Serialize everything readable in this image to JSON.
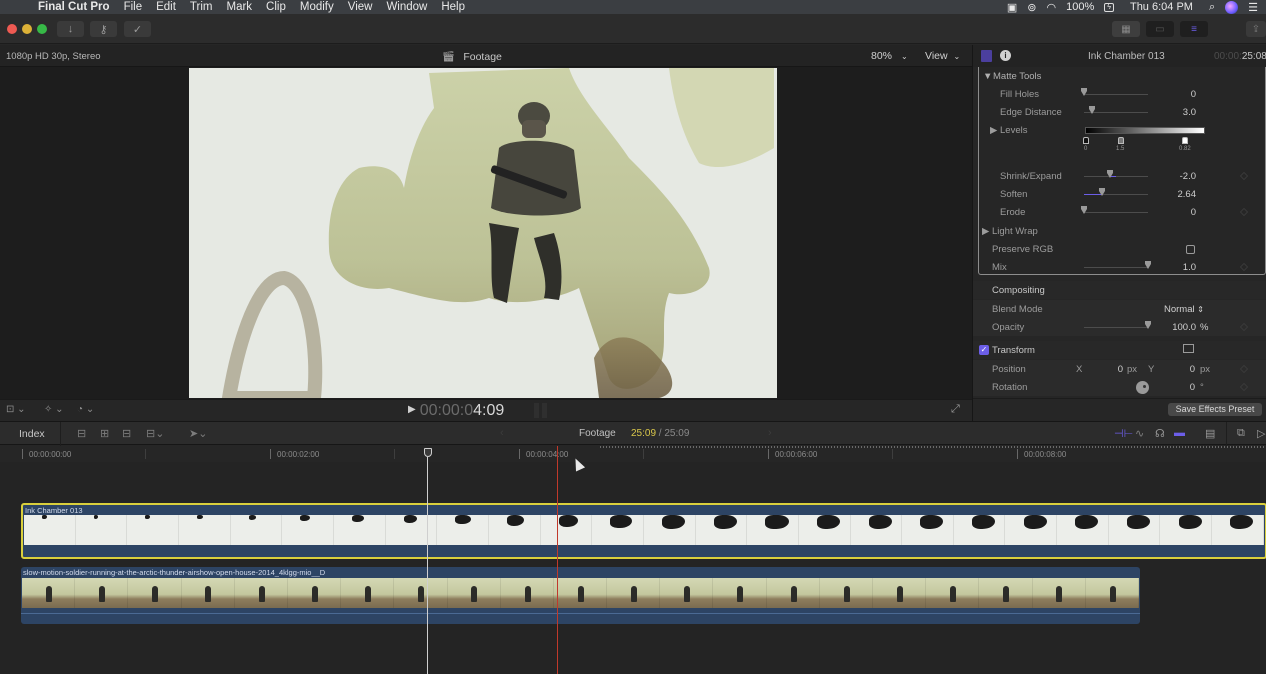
{
  "menubar": {
    "app_name": "Final Cut Pro",
    "items": [
      "File",
      "Edit",
      "Trim",
      "Mark",
      "Clip",
      "Modify",
      "View",
      "Window",
      "Help"
    ],
    "battery": "100%",
    "clock": "Thu 6:04 PM",
    "status_icons": [
      "screen-record-icon",
      "creative-cloud-icon",
      "wifi-icon",
      "battery-charging-icon",
      "spotlight-search-icon",
      "siri-icon",
      "notification-center-icon"
    ]
  },
  "toolbar": {
    "left_buttons": [
      "import-icon",
      "keywords-icon",
      "background-tasks-icon"
    ],
    "right_buttons": [
      "browser-layout-icon",
      "timeline-layout-icon",
      "inspector-icon"
    ],
    "share_icon": "share-icon",
    "accent": "#6c5ee8"
  },
  "viewer": {
    "format": "1080p HD 30p, Stereo",
    "title": "Footage",
    "zoom": "80%",
    "view_menu": "View",
    "timecode_dim": "00:00:0",
    "timecode_bright": "4:09",
    "controls": [
      "transform-tool-icon",
      "enhance-icon",
      "retime-icon"
    ]
  },
  "inspector": {
    "clip_name": "Ink Chamber 013",
    "timecode_dim": "00:00:",
    "timecode_bright": "25:08",
    "matte_tools": {
      "label": "Matte Tools",
      "fill_holes": {
        "label": "Fill Holes",
        "value": "0",
        "fraction": 0.0
      },
      "edge_distance": {
        "label": "Edge Distance",
        "value": "3.0",
        "fraction": 0.12
      },
      "levels": {
        "label": "Levels",
        "markers": [
          "0",
          "1.5",
          "0.82"
        ]
      },
      "shrink_expand": {
        "label": "Shrink/Expand",
        "value": "-2.0",
        "fraction": 0.4
      },
      "soften": {
        "label": "Soften",
        "value": "2.64",
        "fraction": 0.28
      },
      "erode": {
        "label": "Erode",
        "value": "0",
        "fraction": 0.0
      }
    },
    "light_wrap": {
      "label": "Light Wrap"
    },
    "preserve_rgb": {
      "label": "Preserve RGB",
      "checked": false
    },
    "mix": {
      "label": "Mix",
      "value": "1.0",
      "fraction": 1.0
    },
    "compositing": {
      "label": "Compositing",
      "blend_mode": {
        "label": "Blend Mode",
        "value": "Normal"
      },
      "opacity": {
        "label": "Opacity",
        "value": "100.0",
        "unit": "%",
        "fraction": 1.0
      }
    },
    "transform": {
      "label": "Transform",
      "enabled": true,
      "position": {
        "label": "Position",
        "x_label": "X",
        "x": "0",
        "x_unit": "px",
        "y_label": "Y",
        "y": "0",
        "y_unit": "px"
      },
      "rotation": {
        "label": "Rotation",
        "value": "0",
        "unit": "°"
      }
    },
    "save_preset": "Save Effects Preset"
  },
  "timeline_header": {
    "index": "Index",
    "project": "Footage",
    "current": "25:09",
    "separator": " / ",
    "total": "25:09",
    "edit_tools": [
      "connect-icon",
      "insert-icon",
      "append-icon",
      "overwrite-icon",
      "select-tool-icon"
    ],
    "right_tools": [
      "video-only-icon",
      "audio-skimming-icon",
      "solo-headphones-icon",
      "snapping-icon",
      "clip-appearance-icon",
      "timeline-index-icon",
      "effects-browser-icon"
    ]
  },
  "ruler": {
    "labels": [
      "00:00:00:00",
      "00:00:02:00",
      "00:00:04:00",
      "00:00:06:00",
      "00:00:08:00"
    ]
  },
  "clips": [
    {
      "name": "Ink Chamber 013",
      "selected": true
    },
    {
      "name": "slow-motion-soldier-running-at-the-arctic-thunder-airshow-open-house-2014_4klgg-mio__D",
      "selected": false
    }
  ],
  "playhead_time": "00:00:03:09",
  "skimmer_time": "00:00:04:09"
}
